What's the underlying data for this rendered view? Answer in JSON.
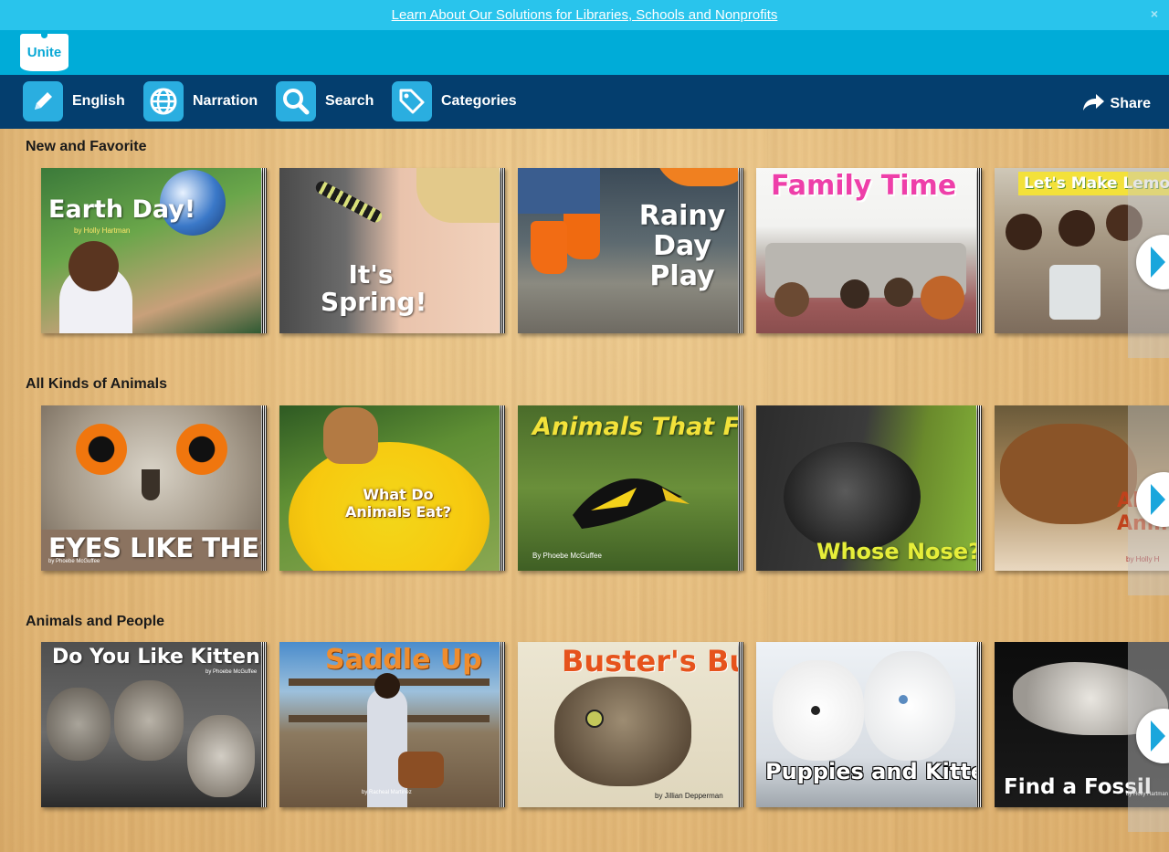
{
  "promo": {
    "text": "Learn About Our Solutions for Libraries, Schools and Nonprofits",
    "close": "×"
  },
  "brand": {
    "logo_text": "Unite"
  },
  "nav": {
    "items": [
      {
        "label": "English",
        "icon": "pencil-icon"
      },
      {
        "label": "Narration",
        "icon": "globe-icon"
      },
      {
        "label": "Search",
        "icon": "search-icon"
      },
      {
        "label": "Categories",
        "icon": "tags-icon"
      }
    ],
    "share": {
      "label": "Share",
      "icon": "share-arrow-icon"
    }
  },
  "colors": {
    "promo": "#29c4ec",
    "brand": "#00acd8",
    "nav": "#043e6e",
    "icon_tile": "#2aaee0"
  },
  "sections": [
    {
      "title": "New and Favorite",
      "books": [
        {
          "title": "Earth Day!",
          "author": "by Holly Hartman"
        },
        {
          "title": "It's Spring!",
          "author": ""
        },
        {
          "title": "Rainy Day Play",
          "author": ""
        },
        {
          "title": "Family Time",
          "author": ""
        },
        {
          "title": "Let's Make Lemonad",
          "author": ""
        }
      ]
    },
    {
      "title": "All Kinds of Animals",
      "books": [
        {
          "title": "EYES LIKE THESE",
          "author": "by Phoebe McGuffee"
        },
        {
          "title": "What Do Animals Eat?",
          "author": ""
        },
        {
          "title": "Animals That Fly",
          "author": "By Phoebe McGuffee"
        },
        {
          "title": "Whose Nose?",
          "author": ""
        },
        {
          "title": "Al Anim",
          "author": "by Holly H"
        }
      ]
    },
    {
      "title": "Animals and People",
      "books": [
        {
          "title": "Do You Like Kittens?",
          "author": "by Phoebe McGuffee"
        },
        {
          "title": "Saddle Up",
          "author": "by Racheal Martinez"
        },
        {
          "title": "Buster's Busy Day",
          "author": "by Jillian Depperman"
        },
        {
          "title": "Puppies and Kittens",
          "author": ""
        },
        {
          "title": "Find a Fossil",
          "author": "by Holly Hartman"
        }
      ]
    }
  ]
}
